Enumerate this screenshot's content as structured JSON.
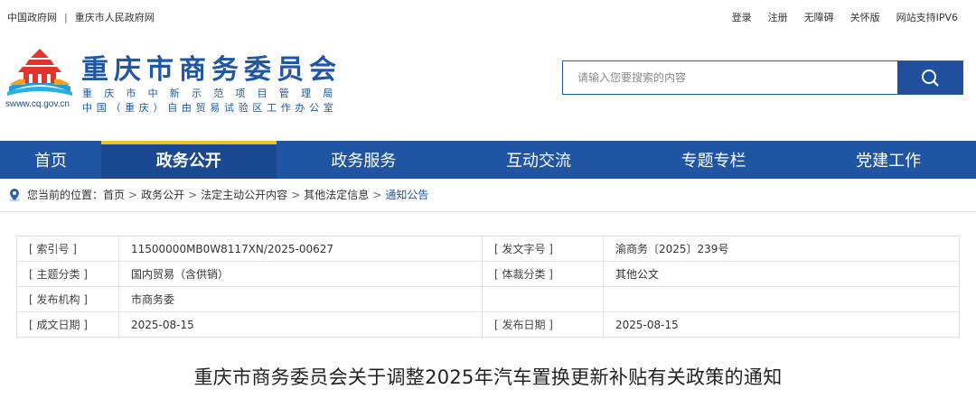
{
  "topbar": {
    "gov_link": "中国政府网",
    "city_link": "重庆市人民政府网",
    "right_links": [
      "登录",
      "注册",
      "无障碍",
      "关怀版",
      "网站支持IPV6"
    ]
  },
  "header": {
    "logo_url_text": "swww.cq.gov.cn",
    "site_title": "重庆市商务委员会",
    "subtitle_1": "重庆市中新示范项目管理局",
    "subtitle_2": "中国（重庆）自由贸易试验区工作办公室"
  },
  "search": {
    "placeholder": "请输入您要搜索的内容",
    "icon": "search-icon"
  },
  "nav": {
    "items": [
      "首页",
      "政务公开",
      "政务服务",
      "互动交流",
      "专题专栏",
      "党建工作"
    ],
    "active_index": 1
  },
  "breadcrumb": {
    "label": "您当前的位置：",
    "items": [
      "首页",
      "政务公开",
      "法定主动公开内容",
      "其他法定信息",
      "通知公告"
    ]
  },
  "meta": {
    "rows": [
      {
        "k1": "[ 索引号 ]",
        "v1": "11500000MB0W8117XN/2025-00627",
        "k2": "[ 发文字号 ]",
        "v2": "渝商务〔2025〕239号"
      },
      {
        "k1": "[ 主题分类 ]",
        "v1": "国内贸易（含供销）",
        "k2": "[ 体裁分类 ]",
        "v2": "其他公文"
      },
      {
        "k1": "[ 发布机构 ]",
        "v1": "市商务委",
        "k2": "",
        "v2": ""
      },
      {
        "k1": "[ 成文日期 ]",
        "v1": "2025-08-15",
        "k2": "[ 发布日期 ]",
        "v2": "2025-08-15"
      }
    ]
  },
  "document": {
    "title": "重庆市商务委员会关于调整2025年汽车置换更新补贴有关政策的通知"
  },
  "colors": {
    "brand_blue": "#1f57a5",
    "nav_blue": "#2055a4",
    "nav_active": "#1a4891",
    "accent_yellow": "#f2c21a"
  }
}
